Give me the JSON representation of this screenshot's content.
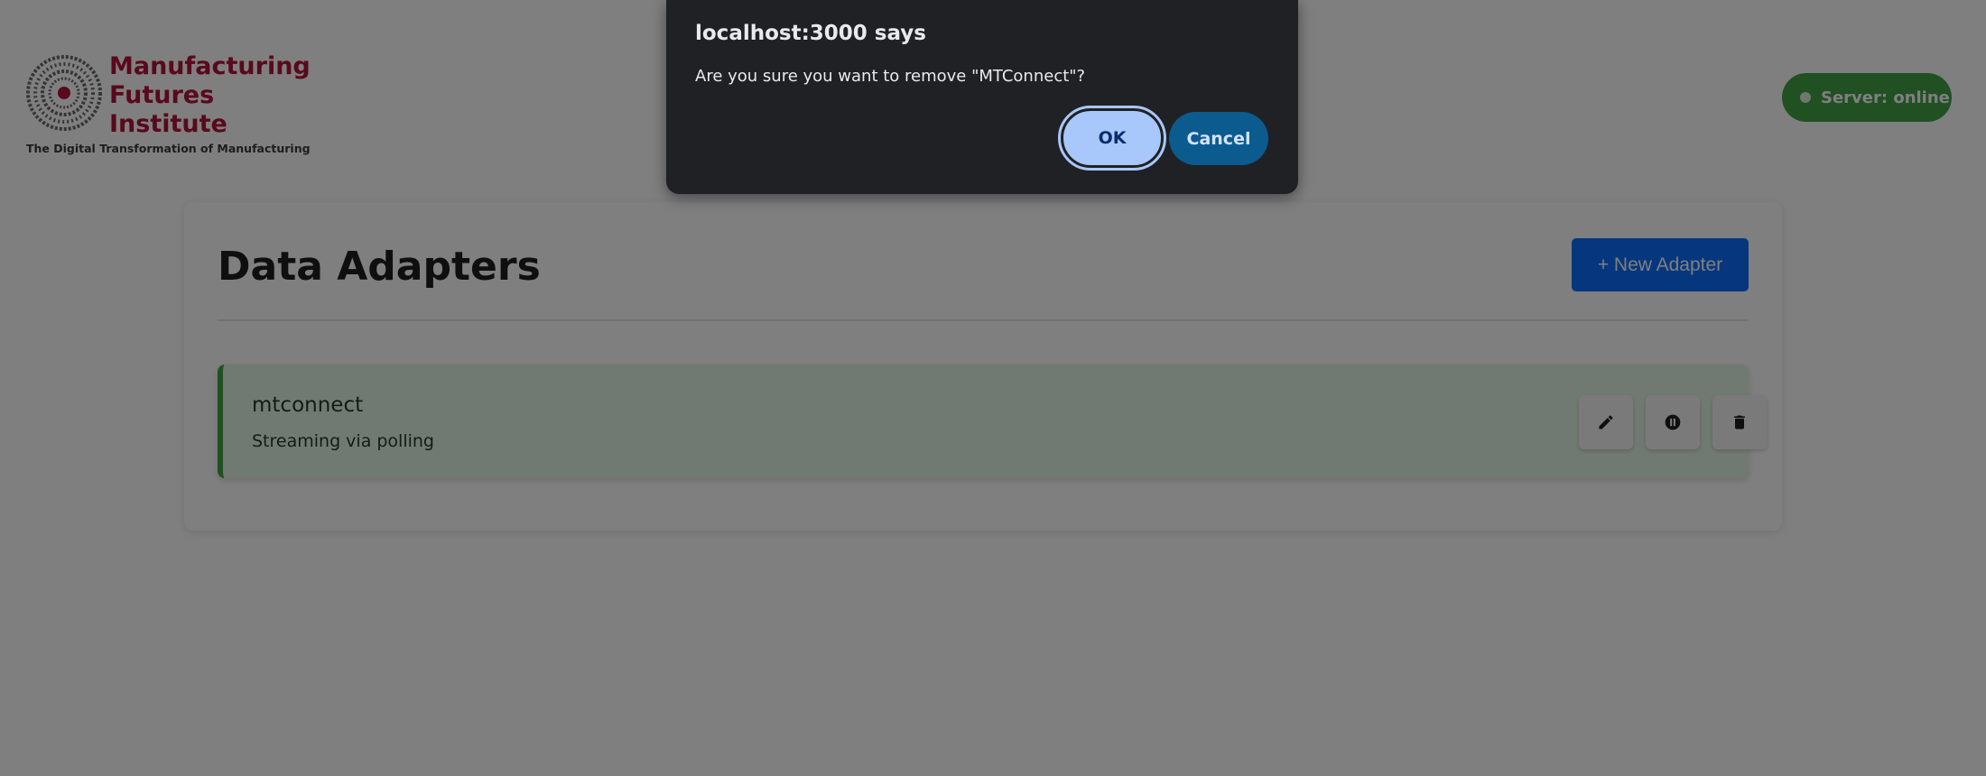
{
  "logo": {
    "name_lines": [
      "Manufacturing",
      "Futures",
      "Institute"
    ],
    "tagline": "The Digital Transformation of Manufacturing"
  },
  "server_status": {
    "label": "Server: online",
    "color": "#43a047"
  },
  "adapters_panel": {
    "title": "Data Adapters",
    "new_button_label": "+ New Adapter",
    "adapters": [
      {
        "name": "mtconnect",
        "status": "Streaming via polling",
        "actions": [
          "pencil-icon",
          "pause-icon",
          "trash-icon"
        ]
      }
    ]
  },
  "dialog": {
    "title": "localhost:3000 says",
    "message": "Are you sure you want to remove \"MTConnect\"?",
    "ok_label": "OK",
    "cancel_label": "Cancel"
  },
  "colors": {
    "brand": "#b3123a",
    "primary_button": "#0d6efd",
    "active_row": "#e3f4e4",
    "dialog_bg": "#202124"
  }
}
